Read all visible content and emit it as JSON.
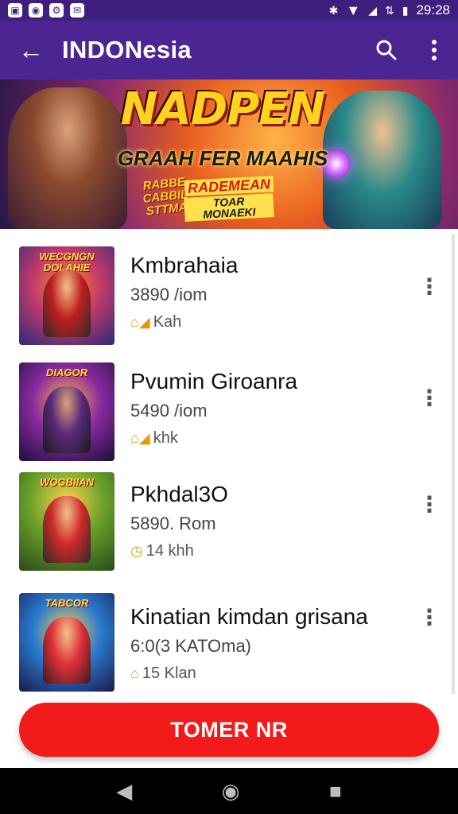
{
  "status_bar": {
    "time": "29:28",
    "left_icons": [
      "app-notification-icon",
      "app-notification-icon",
      "app-notification-icon",
      "app-notification-icon"
    ],
    "right_icons": [
      "bluetooth-icon",
      "wifi-icon",
      "signal-icon",
      "data-icon",
      "battery-icon"
    ]
  },
  "app_bar": {
    "title": "INDONesia",
    "back_icon": "arrow-back-icon",
    "search_icon": "search-icon",
    "menu_icon": "more-vert-icon"
  },
  "banner": {
    "title": "NADPEN",
    "subtitle": "GRAAH FER MAAHIS",
    "badge_left": "RABBE\nCABBIL\nSTTMA",
    "badge_right_top": "RADEMEAN",
    "badge_right_bottom": "TOAR MONAEKI"
  },
  "list": {
    "items": [
      {
        "name": "Kmbrahaia",
        "sub": "3890 /iom",
        "meta": "Kah",
        "meta_icon": "home-fire-icon",
        "thumb_title": "WECGNGN DOLAHIE"
      },
      {
        "name": "Pvumin Giroanra",
        "sub": "5490 /iom",
        "meta": "khk",
        "meta_icon": "home-fire-icon",
        "thumb_title": "DIAGOR"
      },
      {
        "name": "Pkhdal3O",
        "sub": "5890. Rom",
        "meta": "14 khh",
        "meta_icon": "clock-icon",
        "thumb_title": "WOGBIIAN"
      },
      {
        "name": "Kinatian kimdan grisana",
        "sub": "6:0(3 KATOma)",
        "meta": "15 Klan",
        "meta_icon": "home-icon",
        "thumb_title": "TABCOR"
      }
    ]
  },
  "cta": {
    "label": "TOMER NR"
  },
  "nav_bar": {
    "back_icon": "nav-back-icon",
    "home_icon": "nav-home-icon",
    "recents_icon": "nav-recents-icon"
  },
  "colors": {
    "app_bar": "#4b2592",
    "status_bar": "#3f1f7e",
    "cta": "#f21a1a",
    "meta_icon": "#e69a00"
  }
}
